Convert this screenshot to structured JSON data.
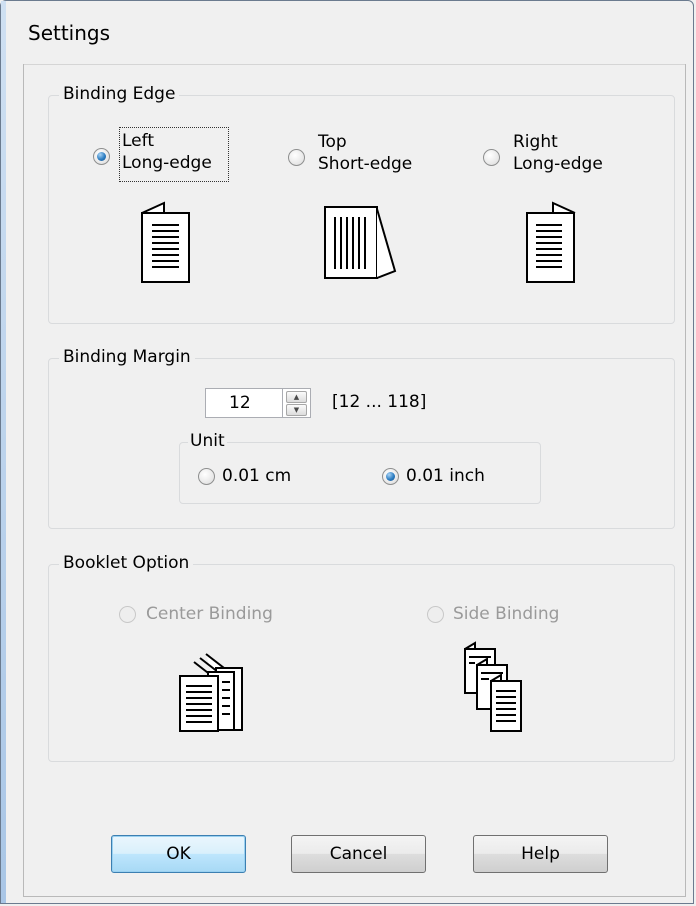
{
  "window": {
    "title": "Settings"
  },
  "binding_edge": {
    "legend": "Binding Edge",
    "options": [
      {
        "line1": "Left",
        "line2": "Long-edge",
        "checked": true
      },
      {
        "line1": "Top",
        "line2": "Short-edge",
        "checked": false
      },
      {
        "line1": "Right",
        "line2": "Long-edge",
        "checked": false
      }
    ]
  },
  "binding_margin": {
    "legend": "Binding Margin",
    "value": "12",
    "range": "[12 ... 118]",
    "unit": {
      "legend": "Unit",
      "options": [
        {
          "label": "0.01 cm",
          "checked": false
        },
        {
          "label": "0.01 inch",
          "checked": true
        }
      ]
    }
  },
  "booklet_option": {
    "legend": "Booklet Option",
    "enabled": false,
    "options": [
      {
        "label": "Center Binding",
        "checked": false
      },
      {
        "label": "Side Binding",
        "checked": false
      }
    ]
  },
  "buttons": {
    "ok": "OK",
    "cancel": "Cancel",
    "help": "Help"
  },
  "colors": {
    "accent": "#2d7ec2",
    "disabled_text": "#9a9a9a"
  }
}
